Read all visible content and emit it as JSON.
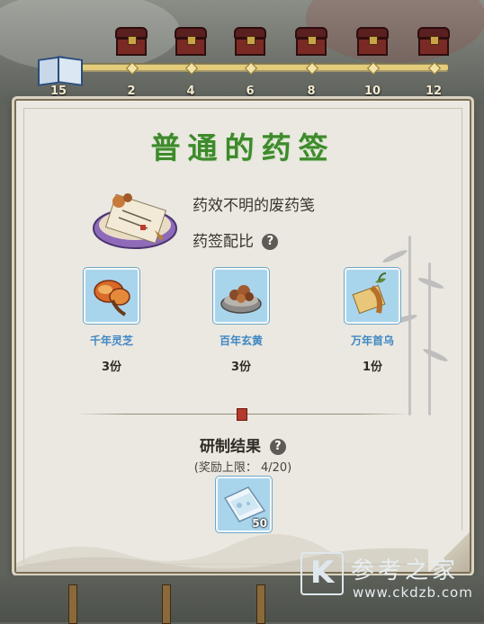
{
  "progress": {
    "current": "15",
    "milestones": [
      "2",
      "4",
      "6",
      "8",
      "10",
      "12"
    ],
    "fill_fraction": 1.0
  },
  "panel": {
    "title": "普通的药签",
    "description": "药效不明的废药笺",
    "ratio_label": "药签配比",
    "help_glyph": "?",
    "ingredients": [
      {
        "name": "千年灵芝",
        "qty": "3份"
      },
      {
        "name": "百年玄黄",
        "qty": "3份"
      },
      {
        "name": "万年首乌",
        "qty": "1份"
      }
    ],
    "result_title": "研制结果",
    "reward_limit": "(奖励上限： 4/20)",
    "reward_count": "50"
  },
  "watermark": {
    "logo": "K",
    "text": "参考之家",
    "url": "www.ckdzb.com"
  },
  "colors": {
    "title_green": "#3e8a2c",
    "ingredient_blue": "#3f88c4",
    "tile_bg": "#a9d5ec",
    "track_fill": "#e5cc7a"
  }
}
